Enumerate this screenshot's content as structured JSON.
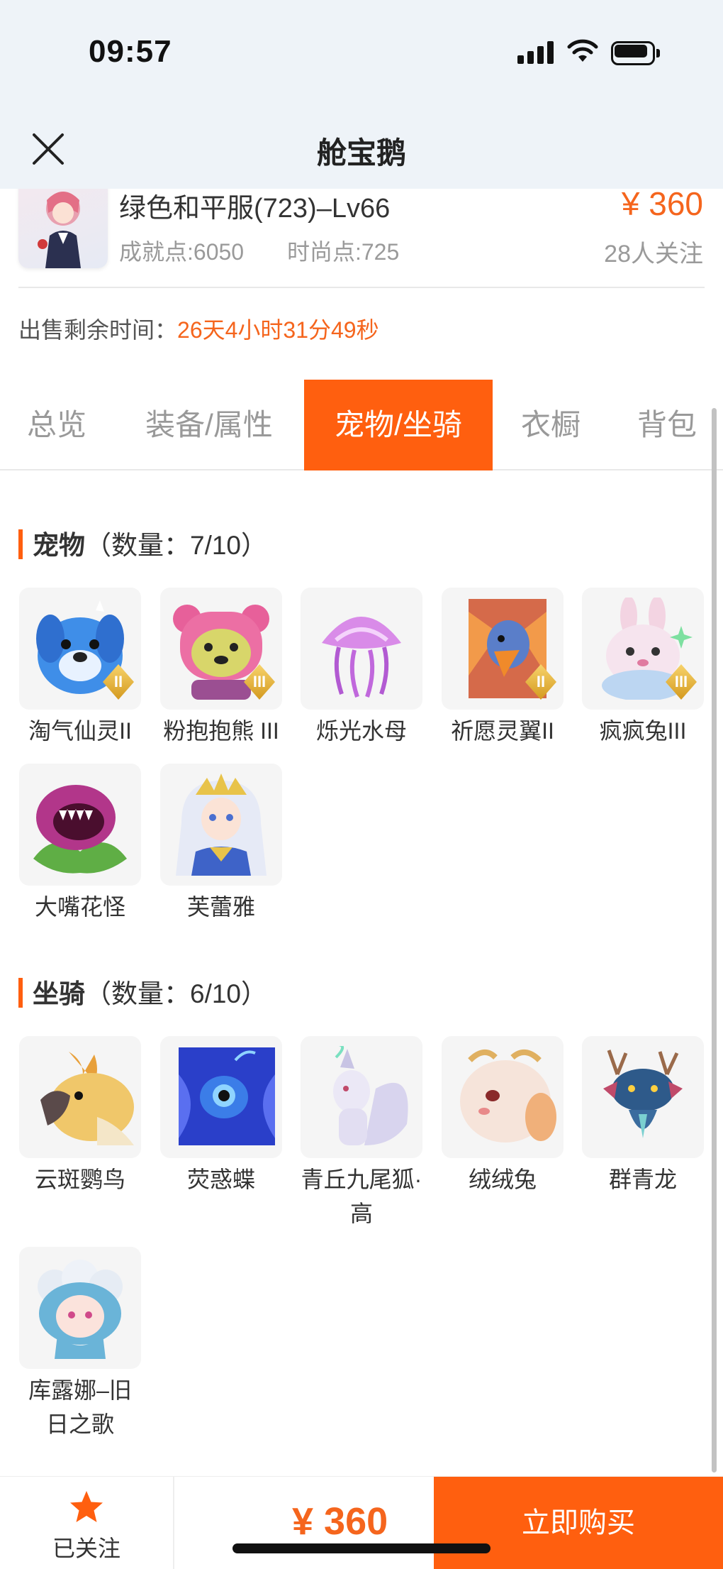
{
  "status_bar": {
    "time": "09:57"
  },
  "header": {
    "title": "舱宝鹅"
  },
  "product": {
    "name": "绿色和平服(723)–Lv66",
    "achievement": "成就点:6050",
    "fashion": "时尚点:725",
    "price": "¥ 360",
    "followers": "28人关注",
    "sale_time_label": "出售剩余时间：",
    "sale_time_value": "26天4小时31分49秒"
  },
  "tabs": [
    {
      "label": "总览"
    },
    {
      "label": "装备/属性"
    },
    {
      "label": "宠物/坐骑"
    },
    {
      "label": "衣橱"
    },
    {
      "label": "背包"
    }
  ],
  "pets": {
    "title": "宠物",
    "count": "（数量：7/10）",
    "items": [
      {
        "name": "淘气仙灵II",
        "badge": "II",
        "icon": "blue-dog-icon"
      },
      {
        "name": "粉抱抱熊 III",
        "badge": "III",
        "icon": "pink-bear-icon"
      },
      {
        "name": "烁光水母",
        "badge": "",
        "icon": "jellyfish-icon"
      },
      {
        "name": "祈愿灵翼II",
        "badge": "II",
        "icon": "bird-wing-icon"
      },
      {
        "name": "疯疯兔III",
        "badge": "III",
        "icon": "rabbit-icon"
      },
      {
        "name": "大嘴花怪",
        "badge": "",
        "icon": "flower-monster-icon"
      },
      {
        "name": "芙蕾雅",
        "badge": "",
        "icon": "goddess-icon"
      }
    ]
  },
  "mounts": {
    "title": "坐骑",
    "count": "（数量：6/10）",
    "items": [
      {
        "name": "云斑鹦鸟",
        "icon": "parrot-icon"
      },
      {
        "name": "荧惑蝶",
        "icon": "butterfly-icon"
      },
      {
        "name": "青丘九尾狐·高",
        "icon": "nine-tail-fox-icon"
      },
      {
        "name": "绒绒兔",
        "icon": "fluffy-rabbit-icon"
      },
      {
        "name": "群青龙",
        "icon": "dragon-icon"
      },
      {
        "name": "库露娜–旧日之歌",
        "icon": "sheep-girl-icon"
      }
    ]
  },
  "bottom_bar": {
    "follow_label": "已关注",
    "price": "¥ 360",
    "buy_label": "立即购买"
  },
  "colors": {
    "accent": "#ff5f0f",
    "price": "#f5651d",
    "header_bg": "#eef3f8"
  }
}
